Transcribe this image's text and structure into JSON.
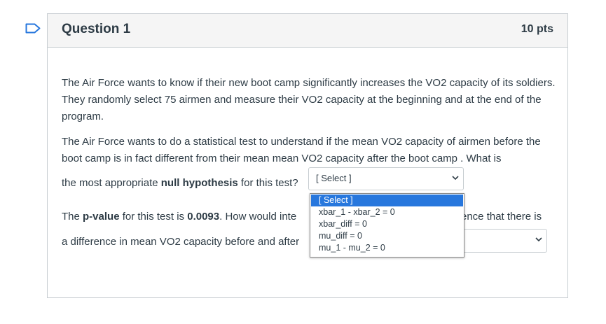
{
  "question": {
    "title": "Question 1",
    "points": "10 pts"
  },
  "body": {
    "p1": "The Air Force wants to know if their new boot camp significantly increases the VO2 capacity of its soldiers. They randomly select 75 airmen and measure their VO2 capacity at the beginning and at the end of the program.",
    "p2": "The Air Force wants to do a statistical test to understand if the mean VO2 capacity of airmen before the boot camp is in fact different from their mean mean VO2 capacity after the boot camp . What is",
    "line3_pre": "the most appropriate ",
    "line3_bold": "null hypothesis",
    "line3_post": " for this test?",
    "line4_a": "The ",
    "line4_b": "p-value",
    "line4_c": " for this test is ",
    "line4_d": "0.0093",
    "line4_e": ". How would inte",
    "line4_tail": "ence that there is",
    "line5": "a difference in mean VO2 capacity before and after"
  },
  "select1": {
    "value": "[ Select ]",
    "options": [
      "[ Select ]",
      "xbar_1 - xbar_2 = 0",
      "xbar_diff = 0",
      "mu_diff = 0",
      "mu_1 - mu_2 = 0"
    ]
  },
  "select2": {
    "value": ""
  },
  "colors": {
    "accent": "#2777dd",
    "text": "#2d3b45",
    "border": "#c7cdd1",
    "header_bg": "#f5f5f5"
  }
}
